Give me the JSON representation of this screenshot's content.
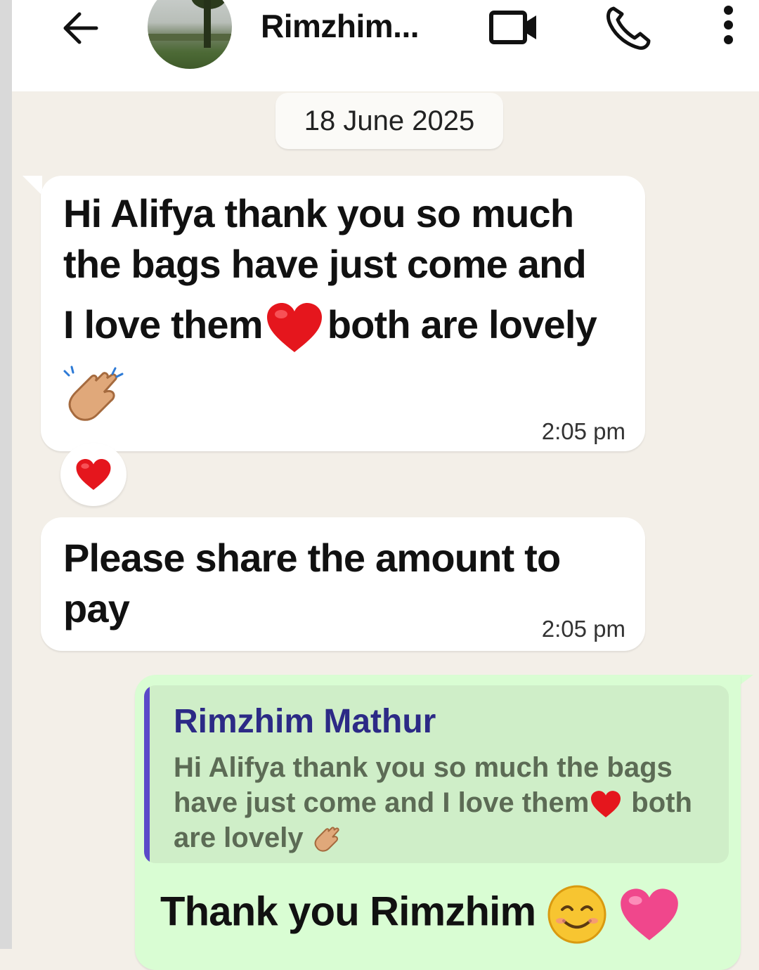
{
  "header": {
    "contact_name": "Rimzhim...",
    "icons": [
      "back-arrow-icon",
      "avatar",
      "video-call-icon",
      "phone-icon",
      "more-options-icon"
    ]
  },
  "date_chip": "18 June 2025",
  "messages": [
    {
      "direction": "incoming",
      "lines": [
        "Hi Alifya thank you so much",
        "the bags have just come and",
        "I love them",
        "both are lovely"
      ],
      "emojis": [
        "red-heart",
        "clapping-hands"
      ],
      "time": "2:05 pm",
      "reaction": "red-heart"
    },
    {
      "direction": "incoming",
      "lines": [
        "Please share the amount to",
        "pay"
      ],
      "time": "2:05 pm"
    },
    {
      "direction": "outgoing",
      "quoted": {
        "author": "Rimzhim Mathur",
        "lines": [
          "Hi Alifya thank you so much the bags",
          "have just come and I love them",
          "both",
          "are lovely"
        ]
      },
      "text": "Thank you Rimzhim",
      "emojis": [
        "smiling-face",
        "pink-heart"
      ]
    }
  ],
  "colors": {
    "chat_background": "#f3efe8",
    "incoming_bubble": "#ffffff",
    "outgoing_bubble": "#d9fdd3",
    "quote_background": "#cfeec8",
    "quote_bar": "#5b4ac9",
    "quote_author": "#2c2a86"
  }
}
